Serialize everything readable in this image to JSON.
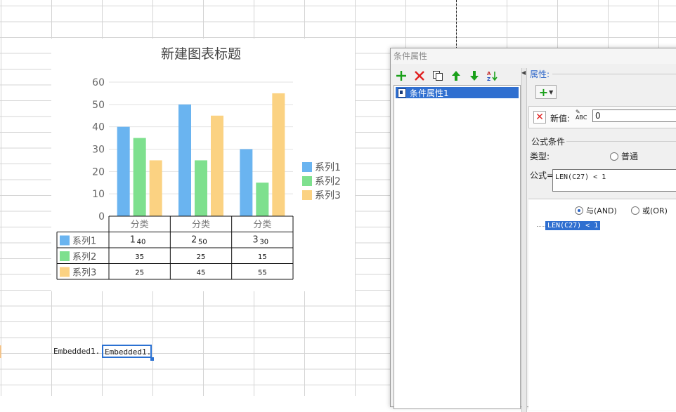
{
  "chart_data": {
    "type": "bar",
    "title": "新建图表标题",
    "categories": [
      "分类",
      "分类",
      "分类"
    ],
    "category_marks": [
      "1",
      "2",
      "3"
    ],
    "series": [
      {
        "name": "系列1",
        "color": "#6ab4f0",
        "values": [
          40,
          50,
          30
        ]
      },
      {
        "name": "系列2",
        "color": "#7ee08e",
        "values": [
          35,
          25,
          15
        ]
      },
      {
        "name": "系列3",
        "color": "#fbd282",
        "values": [
          25,
          45,
          55
        ]
      }
    ],
    "ylim": [
      0,
      60
    ],
    "yticks": [
      0,
      10,
      20,
      30,
      40,
      50,
      60
    ],
    "grid": true,
    "legend": "right",
    "data_table": true
  },
  "sheet": {
    "cell_a": "Embedded1.",
    "cell_b": "Embedded1."
  },
  "dialog": {
    "title": "条件属性",
    "toolbar": [
      "add",
      "delete",
      "copy",
      "move-up",
      "move-down",
      "sort"
    ],
    "list_item": "条件属性1",
    "props_label": "属性:",
    "newval_label": "新值:",
    "abc_icon_text": "ABC",
    "newval_value": "0",
    "formula_section_label": "公式条件",
    "type_label": "类型:",
    "type_normal": "普通",
    "formula_label": "公式=",
    "formula_value": "LEN(C27) < 1",
    "and_label": "与(AND)",
    "or_label": "或(OR)",
    "condition_node": "LEN(C27) < 1"
  },
  "colors": {
    "selection": "#2f6fd0",
    "add_green": "#1aa01a",
    "delete_red": "#e02020",
    "props_blue": "#2a64c8"
  }
}
